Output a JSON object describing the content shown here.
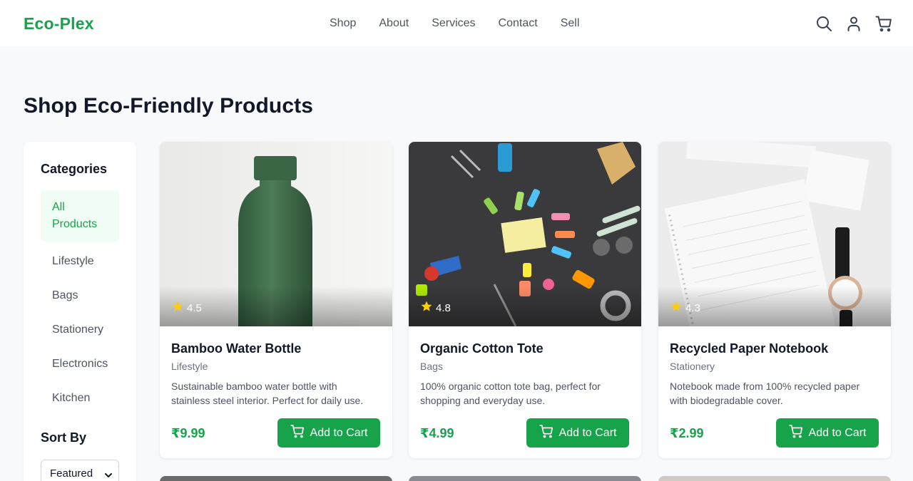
{
  "header": {
    "logo": "Eco-Plex",
    "nav": [
      "Shop",
      "About",
      "Services",
      "Contact",
      "Sell"
    ],
    "icons": [
      "search-icon",
      "user-icon",
      "cart-icon"
    ]
  },
  "page": {
    "title": "Shop Eco-Friendly Products"
  },
  "sidebar": {
    "categories_heading": "Categories",
    "categories": [
      {
        "label": "All Products",
        "active": true
      },
      {
        "label": "Lifestyle"
      },
      {
        "label": "Bags"
      },
      {
        "label": "Stationery"
      },
      {
        "label": "Electronics"
      },
      {
        "label": "Kitchen"
      }
    ],
    "sort_heading": "Sort By",
    "sort_selected": "Featured"
  },
  "products": [
    {
      "rating": "4.5",
      "name": "Bamboo Water Bottle",
      "category": "Lifestyle",
      "description": "Sustainable bamboo water bottle with stainless steel interior. Perfect for daily use.",
      "price": "₹9.99",
      "button": "Add to Cart"
    },
    {
      "rating": "4.8",
      "name": "Organic Cotton Tote",
      "category": "Bags",
      "description": "100% organic cotton tote bag, perfect for shopping and everyday use.",
      "price": "₹4.99",
      "button": "Add to Cart"
    },
    {
      "rating": "4.3",
      "name": "Recycled Paper Notebook",
      "category": "Stationery",
      "description": "Notebook made from 100% recycled paper with biodegradable cover.",
      "price": "₹2.99",
      "button": "Add to Cart"
    }
  ],
  "colors": {
    "brand": "#16a34a",
    "active_bg": "#f0fdf4",
    "star": "#facc15"
  }
}
